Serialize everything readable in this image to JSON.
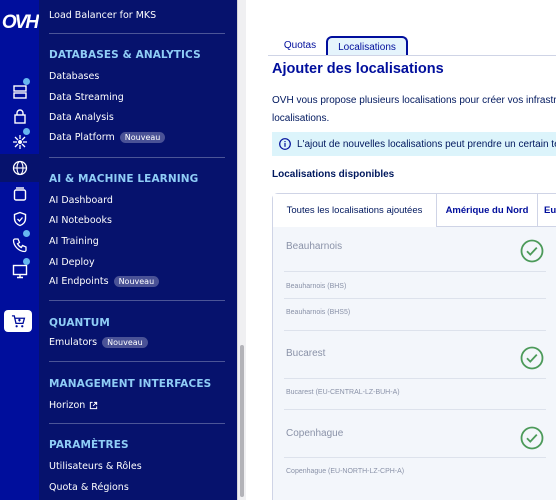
{
  "rail": {
    "logo": "OVH",
    "icons": [
      "server-icon",
      "lock-icon",
      "network-icon",
      "globe-icon",
      "box-icon",
      "shield-icon",
      "phone-icon",
      "monitor-icon",
      "cart-icon"
    ]
  },
  "nav": {
    "top_item": "Load Balancer for MKS",
    "badge_new": "Nouveau",
    "sections": {
      "databases": {
        "title": "DATABASES & ANALYTICS",
        "items": [
          "Databases",
          "Data Streaming",
          "Data Analysis",
          "Data Platform"
        ]
      },
      "ai": {
        "title": "AI & MACHINE LEARNING",
        "items": [
          "AI Dashboard",
          "AI Notebooks",
          "AI Training",
          "AI Deploy",
          "AI Endpoints"
        ]
      },
      "quantum": {
        "title": "QUANTUM",
        "items": [
          "Emulators"
        ]
      },
      "management": {
        "title": "MANAGEMENT INTERFACES",
        "items": [
          "Horizon"
        ]
      },
      "settings": {
        "title": "PARAMÈTRES",
        "items": [
          "Utilisateurs & Rôles",
          "Quota & Régions"
        ]
      }
    }
  },
  "main": {
    "tabs": [
      "Quotas",
      "Localisations"
    ],
    "active_tab": "Localisations",
    "title": "Ajouter des localisations",
    "description_line1": "OVH vous propose plusieurs localisations pour créer vos infrastru",
    "description_line2": "localisations.",
    "info": "L'ajout de nouvelles localisations peut prendre un certain te",
    "available_label": "Localisations disponibles",
    "location_tabs": [
      "Toutes les localisations ajoutées",
      "Amérique du Nord",
      "Eu"
    ],
    "locations": [
      {
        "name": "Beauharnois",
        "codes": [
          "Beauharnois (BHS)",
          "Beauharnois (BHS5)"
        ],
        "added": true
      },
      {
        "name": "Bucarest",
        "codes": [
          "Bucarest (EU-CENTRAL-LZ-BUH-A)"
        ],
        "added": true
      },
      {
        "name": "Copenhague",
        "codes": [
          "Copenhague (EU-NORTH-LZ-CPH-A)"
        ],
        "added": true
      }
    ]
  },
  "colors": {
    "rail_bg": "#000e9c",
    "nav_bg": "#06126d",
    "section_title": "#8fcdf6",
    "primary": "#000e9c",
    "info_bg": "#dcf4fb",
    "check_green": "#4c9a5a"
  }
}
